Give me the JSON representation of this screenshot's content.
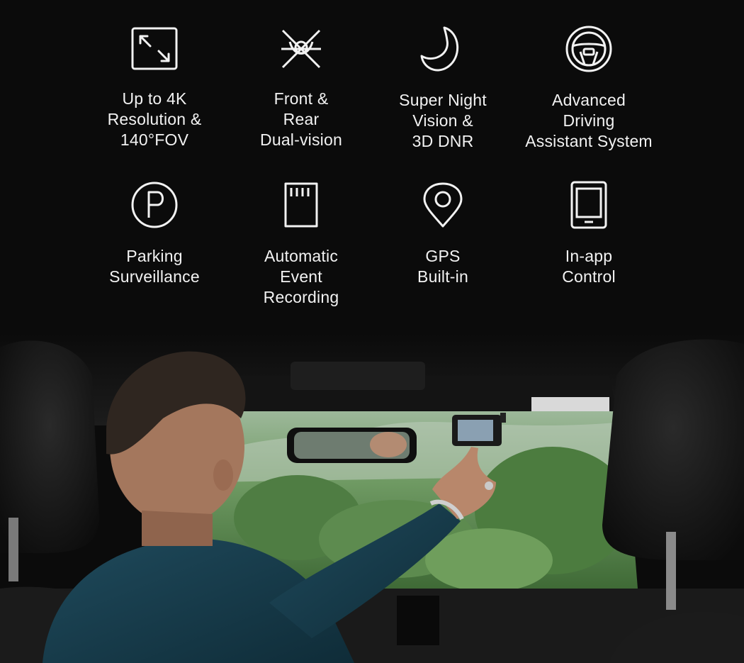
{
  "features": [
    {
      "icon": "expand-arrows-icon",
      "label": "Up to 4K\nResolution &\n140°FOV"
    },
    {
      "icon": "crossed-camera-icon",
      "label": "Front &\nRear\nDual-vision"
    },
    {
      "icon": "crescent-moon-icon",
      "label": "Super Night\nVision &\n3D DNR"
    },
    {
      "icon": "steering-wheel-icon",
      "label": "Advanced\nDriving\nAssistant System"
    },
    {
      "icon": "parking-icon",
      "label": "Parking\nSurveillance"
    },
    {
      "icon": "sd-card-icon",
      "label": "Automatic\nEvent\nRecording"
    },
    {
      "icon": "location-pin-icon",
      "label": "GPS\nBuilt-in"
    },
    {
      "icon": "tablet-icon",
      "label": "In-app\nControl"
    }
  ],
  "colors": {
    "background": "#0b0b0b",
    "text": "#f2f2f2",
    "foliage": "#5a8a4a"
  }
}
